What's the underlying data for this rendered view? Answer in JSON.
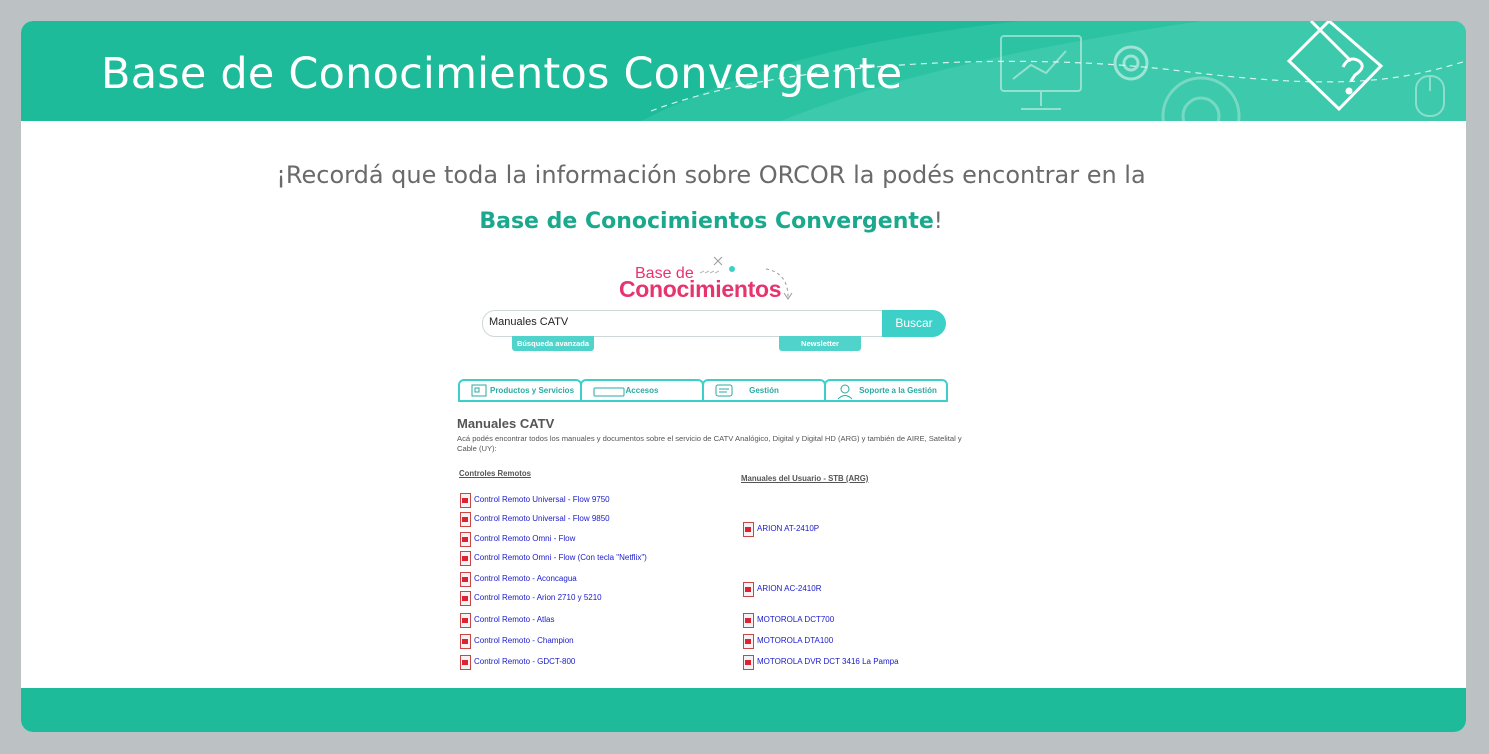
{
  "header": {
    "title": "Base de Conocimientos Convergente"
  },
  "note": {
    "line1": "¡Recordá que toda la información sobre ORCOR la podés encontrar en la",
    "highlight": "Base de Conocimientos Convergente",
    "bang": "!"
  },
  "embedded": {
    "logo": {
      "top": "Base de",
      "main": "Conocimientos"
    },
    "search": {
      "value": "Manuales CATV",
      "button": "Buscar"
    },
    "links": {
      "advanced": "Búsqueda avanzada",
      "newsletter": "Newsletter"
    },
    "tabs": [
      {
        "label": "Productos y Servicios",
        "icon": "products-icon"
      },
      {
        "label": "Accesos",
        "icon": "keyboard-icon"
      },
      {
        "label": "Gestión",
        "icon": "chat-icon"
      },
      {
        "label": "Soporte a la Gestión",
        "icon": "support-icon"
      }
    ],
    "section": {
      "title": "Manuales CATV",
      "description": "Acá podés encontrar todos los manuales y documentos sobre el servicio de CATV Analógico, Digital y Digital HD (ARG) y también de AIRE, Satelital y Cable (UY):"
    },
    "left_column": {
      "heading": "Controles Remotos",
      "items": [
        "Control Remoto Universal - Flow 9750",
        "Control Remoto Universal - Flow 9850",
        "Control Remoto Omni - Flow",
        "Control Remoto Omni - Flow (Con tecla \"Netflix\")",
        "Control Remoto - Aconcagua",
        "Control Remoto - Arion 2710 y 5210",
        "Control Remoto - Atlas",
        "Control Remoto - Champion",
        "Control Remoto - GDCT-800"
      ]
    },
    "right_column": {
      "heading": "Manuales del Usuario - STB (ARG)",
      "items": [
        "ARION AT-2410P",
        "ARION AC-2410R",
        "MOTOROLA DCT700",
        "MOTOROLA DTA100",
        "MOTOROLA DVR DCT 3416 La Pampa"
      ]
    }
  },
  "colors": {
    "brand": "#1dbb99",
    "accent": "#3dd0c9",
    "logo": "#e8346e",
    "link": "#1a1acc"
  }
}
